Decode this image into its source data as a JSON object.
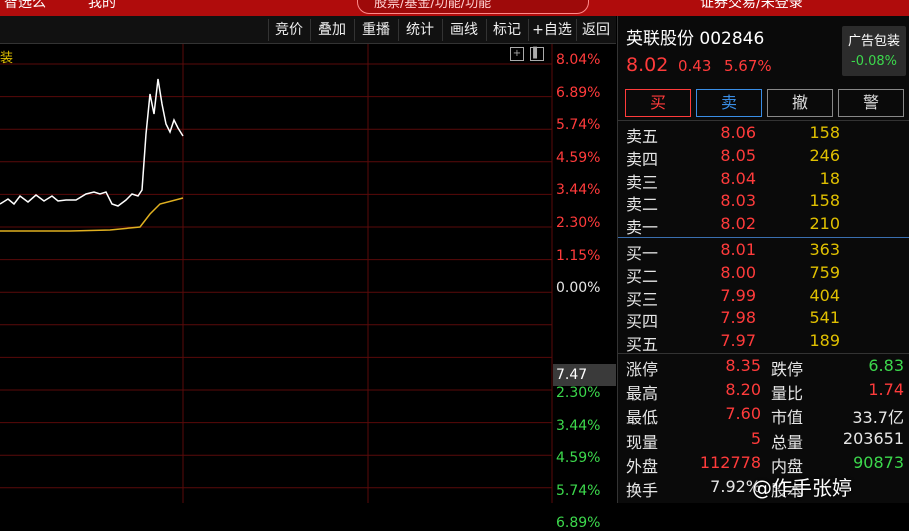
{
  "topbar": {
    "left_a": "智选么",
    "left_b": "我的",
    "search_placeholder": "股票/基金/功能/功能",
    "right_text": "证券交易/未登录"
  },
  "toolbar": {
    "buttons": [
      "竞价",
      "叠加",
      "重播",
      "统计",
      "画线",
      "标记",
      "+自选",
      "返回"
    ]
  },
  "chart": {
    "title": "装",
    "pct_labels": [
      "8.04%",
      "6.89%",
      "5.74%",
      "4.59%",
      "3.44%",
      "2.30%",
      "1.15%",
      "0.00%",
      "2.30%",
      "3.44%",
      "4.59%",
      "5.74%",
      "6.89%"
    ],
    "current_price_tag": "7.47",
    "colors": {
      "up": "#ff3b3b",
      "down": "#3cd84c",
      "price_line": "#ffffff",
      "avg_line": "#e0b020",
      "grid": "#5a0a0a"
    }
  },
  "stock": {
    "name": "英联股份",
    "code": "002846",
    "price": "8.02",
    "change": "0.43",
    "change_pct": "5.67%",
    "ad_label": "广告包装",
    "ad_value": "-0.08%"
  },
  "actions": {
    "buy": "买",
    "sell": "卖",
    "cancel": "撤",
    "alert": "警"
  },
  "order_book": {
    "asks": [
      {
        "label": "卖五",
        "price": "8.06",
        "vol": "158"
      },
      {
        "label": "卖四",
        "price": "8.05",
        "vol": "246"
      },
      {
        "label": "卖三",
        "price": "8.04",
        "vol": "18"
      },
      {
        "label": "卖二",
        "price": "8.03",
        "vol": "158"
      },
      {
        "label": "卖一",
        "price": "8.02",
        "vol": "210"
      }
    ],
    "bids": [
      {
        "label": "买一",
        "price": "8.01",
        "vol": "363"
      },
      {
        "label": "买二",
        "price": "8.00",
        "vol": "759"
      },
      {
        "label": "买三",
        "price": "7.99",
        "vol": "404"
      },
      {
        "label": "买四",
        "price": "7.98",
        "vol": "541"
      },
      {
        "label": "买五",
        "price": "7.97",
        "vol": "189"
      }
    ]
  },
  "stats": [
    {
      "l1": "涨停",
      "v1": "8.35",
      "c1": "#ff3b3b",
      "l2": "跌停",
      "v2": "6.83",
      "c2": "#3cd84c"
    },
    {
      "l1": "最高",
      "v1": "8.20",
      "c1": "#ff3b3b",
      "l2": "量比",
      "v2": "1.74",
      "c2": "#ff3b3b"
    },
    {
      "l1": "最低",
      "v1": "7.60",
      "c1": "#ff3b3b",
      "l2": "市值",
      "v2": "33.7亿",
      "c2": "#e6e6e6"
    },
    {
      "l1": "现量",
      "v1": "5",
      "c1": "#ff3b3b",
      "l2": "总量",
      "v2": "203651",
      "c2": "#e6e6e6"
    },
    {
      "l1": "外盘",
      "v1": "112778",
      "c1": "#ff3b3b",
      "l2": "内盘",
      "v2": "90873",
      "c2": "#3cd84c"
    },
    {
      "l1": "换手",
      "v1": "7.92%",
      "c1": "#e6e6e6",
      "l2": "股本",
      "v2": "",
      "c2": "#e6e6e6"
    }
  ],
  "watermark": "@作手张婷"
}
